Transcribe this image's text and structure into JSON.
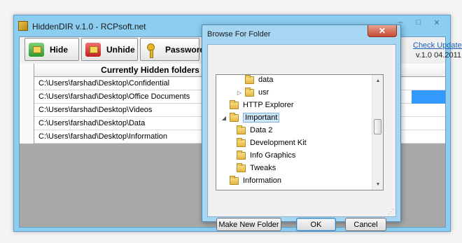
{
  "main_window": {
    "title": "HiddenDIR v.1.0 - RCPsoft.net",
    "controls": [
      "–",
      "□",
      "✕"
    ]
  },
  "toolbar": {
    "hide_label": "Hide",
    "unhide_label": "Unhide",
    "password_label": "Password"
  },
  "update_link": "Check Updates",
  "version_text": "v.1.0 04.2011",
  "grid": {
    "column_header": "Currently Hidden folders",
    "rows": [
      "C:\\Users\\farshad\\Desktop\\Confidential",
      "C:\\Users\\farshad\\Desktop\\Office Documents",
      "C:\\Users\\farshad\\Desktop\\Videos",
      "C:\\Users\\farshad\\Desktop\\Data",
      "C:\\Users\\farshad\\Desktop\\Information"
    ]
  },
  "dialog": {
    "title": "Browse For Folder",
    "close": "✕",
    "tree": [
      {
        "label": "data",
        "expander": ""
      },
      {
        "label": "usr",
        "expander": "▷"
      },
      {
        "label": "HTTP Explorer",
        "expander": ""
      },
      {
        "label": "Important",
        "expander": "◢"
      },
      {
        "label": "Data 2",
        "expander": ""
      },
      {
        "label": "Development Kit",
        "expander": ""
      },
      {
        "label": "Info Graphics",
        "expander": ""
      },
      {
        "label": "Tweaks",
        "expander": ""
      },
      {
        "label": "Information",
        "expander": ""
      }
    ],
    "scroll_up": "▲",
    "scroll_down": "▼",
    "new_folder_label": "Make New Folder",
    "ok_label": "OK",
    "cancel_label": "Cancel"
  }
}
